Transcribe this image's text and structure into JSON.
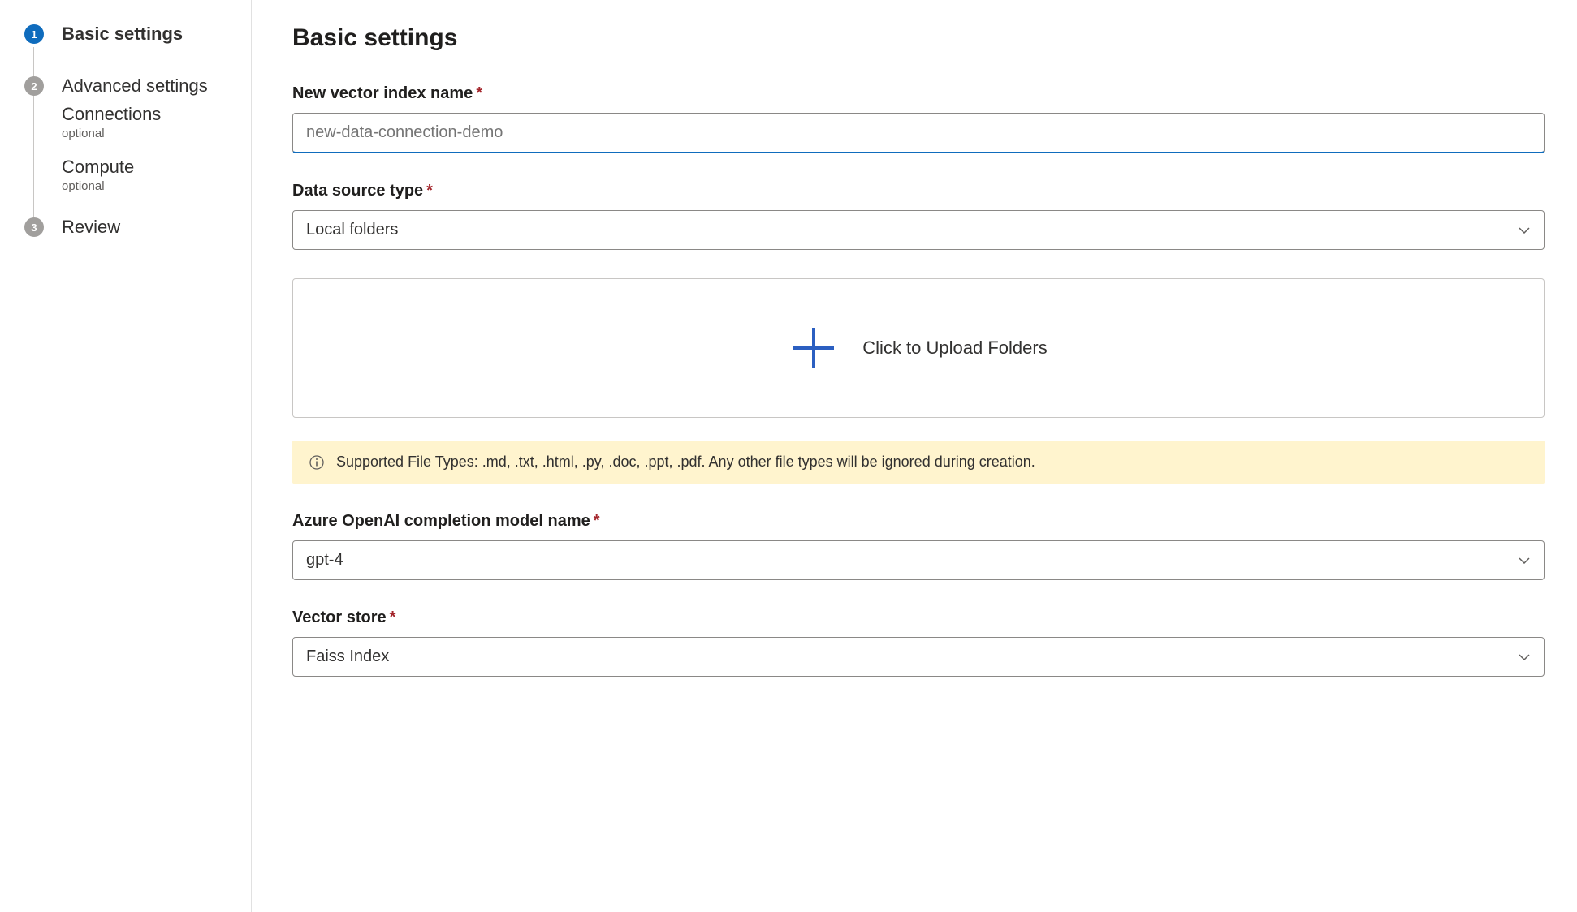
{
  "steps": [
    {
      "number": "1",
      "label": "Basic settings",
      "active": true,
      "bold": true
    },
    {
      "number": "2",
      "label": "Advanced settings",
      "active": false,
      "bold": false,
      "subs": [
        {
          "label": "Connections",
          "hint": "optional"
        },
        {
          "label": "Compute",
          "hint": "optional"
        }
      ]
    },
    {
      "number": "3",
      "label": "Review",
      "active": false,
      "bold": false
    }
  ],
  "main": {
    "title": "Basic settings",
    "fields": {
      "index_name": {
        "label": "New vector index name",
        "placeholder": "new-data-connection-demo",
        "value": ""
      },
      "source_type": {
        "label": "Data source type",
        "value": "Local folders"
      },
      "upload": {
        "text": "Click to Upload Folders"
      },
      "banner": {
        "text": "Supported File Types: .md, .txt, .html, .py, .doc, .ppt, .pdf. Any other file types will be ignored during creation."
      },
      "model_name": {
        "label": "Azure OpenAI completion model name",
        "value": "gpt-4"
      },
      "vector_store": {
        "label": "Vector store",
        "value": "Faiss Index"
      }
    }
  }
}
